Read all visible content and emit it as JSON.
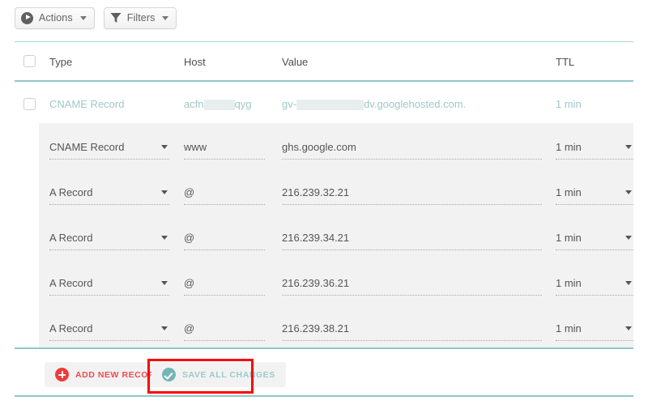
{
  "toolbar": {
    "actions": {
      "label": "Actions",
      "icon": "play-circle-icon",
      "caret": "chevron-down-icon"
    },
    "filters": {
      "label": "Filters",
      "icon": "funnel-icon",
      "caret": "chevron-down-icon"
    }
  },
  "table": {
    "columns": [
      {
        "key": "type",
        "label": "Type"
      },
      {
        "key": "host",
        "label": "Host"
      },
      {
        "key": "value",
        "label": "Value"
      },
      {
        "key": "ttl",
        "label": "TTL"
      }
    ],
    "select_all_checkbox": {
      "checked": false
    },
    "static_rows": [
      {
        "checkbox": {
          "checked": false
        },
        "type": "CNAME Record",
        "host_prefix": "acfn",
        "host_redacted": true,
        "host_suffix": "qyg",
        "value_prefix": "gv-",
        "value_redacted": true,
        "value_suffix": "dv.googlehosted.com.",
        "ttl": "1 min"
      }
    ],
    "editable_rows": [
      {
        "type": "CNAME Record",
        "host": "www",
        "value": "ghs.google.com",
        "ttl": "1 min"
      },
      {
        "type": "A Record",
        "host": "@",
        "value": "216.239.32.21",
        "ttl": "1 min"
      },
      {
        "type": "A Record",
        "host": "@",
        "value": "216.239.34.21",
        "ttl": "1 min"
      },
      {
        "type": "A Record",
        "host": "@",
        "value": "216.239.36.21",
        "ttl": "1 min"
      },
      {
        "type": "A Record",
        "host": "@",
        "value": "216.239.38.21",
        "ttl": "1 min"
      }
    ]
  },
  "footer": {
    "add_new_record": {
      "label": "ADD NEW RECORD",
      "icon": "plus-circle-icon"
    },
    "save_all_changes": {
      "label": "SAVE ALL CHANGES",
      "icon": "check-circle-icon",
      "highlighted": true
    }
  },
  "colors": {
    "teal_divider": "#8fc7c7",
    "teal_text": "#9fc9c9",
    "red_accent": "#ef3b3b",
    "row_background": "#f2f2f2",
    "annotation_box": "#ff0000"
  }
}
